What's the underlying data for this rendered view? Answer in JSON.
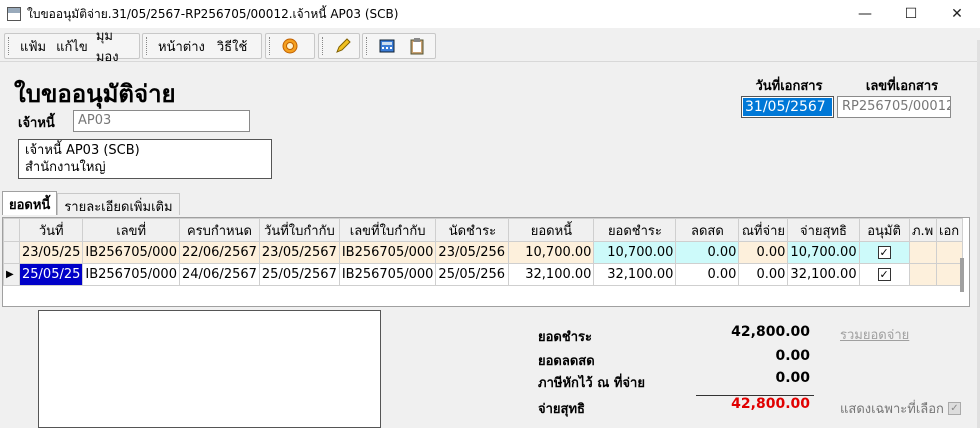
{
  "window": {
    "title": "ใบขออนุมัติจ่าย.31/05/2567-RP256705/00012.เจ้าหนี้ AP03 (SCB)",
    "minimize": "—",
    "maximize": "☐",
    "close": "✕"
  },
  "menu": {
    "file": "แฟ้ม",
    "edit": "แก้ไข",
    "view": "มุมมอง",
    "window": "หน้าต่าง",
    "help": "วิธีใช้"
  },
  "form": {
    "title": "ใบขออนุมัติจ่าย",
    "creditor_label": "เจ้าหนี้",
    "creditor_code": "AP03",
    "creditor_memo_line1": "เจ้าหนี้ AP03 (SCB)",
    "creditor_memo_line2": "สำนักงานใหญ่",
    "doc_date_label": "วันที่เอกสาร",
    "doc_no_label": "เลขที่เอกสาร",
    "doc_date": "31/05/2567",
    "doc_no": "RP256705/00012"
  },
  "tabs": [
    {
      "label": "ยอดหนี้"
    },
    {
      "label": "รายละเอียดเพิ่มเติม"
    }
  ],
  "grid": {
    "columns": [
      "วันที่",
      "เลขที่",
      "ครบกำหนด",
      "วันที่ใบกำกับ",
      "เลขที่ใบกำกับ",
      "นัดชำระ",
      "ยอดหนี้",
      "ยอดชำระ",
      "ลดสด",
      "ณที่จ่าย",
      "จ่ายสุทธิ",
      "อนุมัติ",
      "ภ.พ",
      "เอก"
    ],
    "rows": [
      {
        "date": "23/05/25",
        "no": "IB256705/000",
        "due": "22/06/2567",
        "inv_date": "23/05/2567",
        "inv_no": "IB256705/000",
        "pay_date": "23/05/256",
        "debt": "10,700.00",
        "pay": "10,700.00",
        "disc": "0.00",
        "wht": "0.00",
        "net": "10,700.00",
        "approved": "✓"
      },
      {
        "date": "25/05/25",
        "no": "IB256705/000",
        "due": "24/06/2567",
        "inv_date": "25/05/2567",
        "inv_no": "IB256705/000",
        "pay_date": "25/05/256",
        "debt": "32,100.00",
        "pay": "32,100.00",
        "disc": "0.00",
        "wht": "0.00",
        "net": "32,100.00",
        "approved": "✓"
      }
    ]
  },
  "summary": {
    "pay_label": "ยอดชำระ",
    "pay_value": "42,800.00",
    "disc_label": "ยอดลดสด",
    "disc_value": "0.00",
    "wht_label": "ภาษีหักไว้ ณ ที่จ่าย",
    "wht_value": "0.00",
    "net_label": "จ่ายสุทธิ",
    "net_value": "42,800.00",
    "total_link": "รวมยอดจ่าย",
    "show_selected": "แสดงเฉพาะที่เลือก"
  },
  "colors": {
    "net_value": "#e00000",
    "selection": "#0078d7"
  }
}
